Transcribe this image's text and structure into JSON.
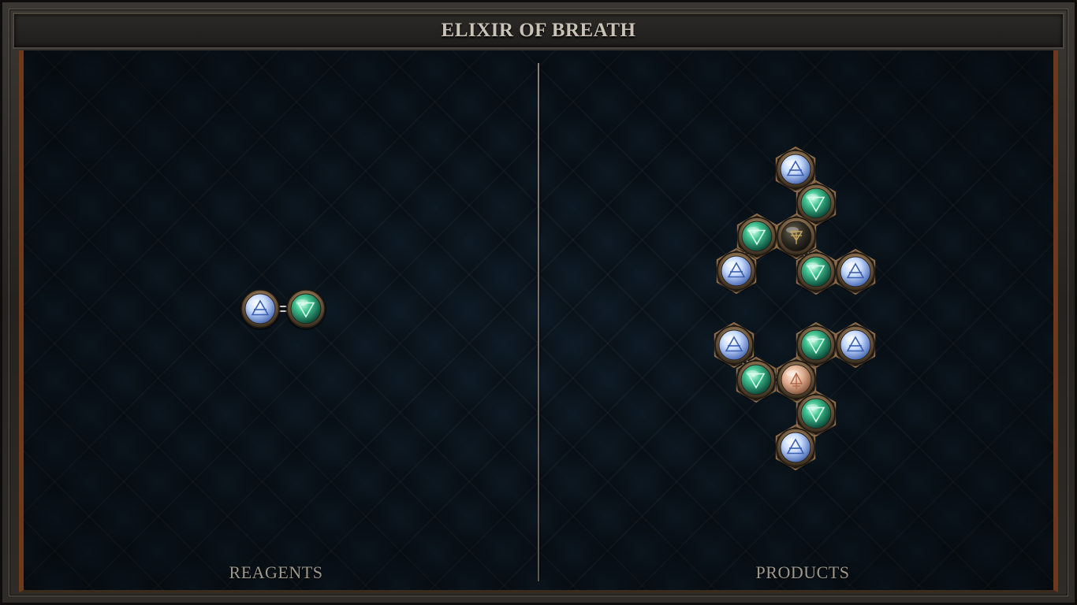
{
  "title": "ELIXIR OF BREATH",
  "panels": {
    "reagents_label": "REAGENTS",
    "products_label": "PRODUCTS"
  },
  "symbols": {
    "air": "air-triangle-icon",
    "water": "water-triangle-icon",
    "salt": "salt-triangle-icon",
    "fire": "fire-triangle-icon"
  },
  "colors": {
    "air": "#cfe0ff",
    "water": "#44c29a",
    "dark_center": "#2b2a22",
    "copper_center": "#e4b498",
    "frame_brass": "#8b6b4a"
  },
  "molecules": {
    "reagent": {
      "atoms": [
        "air",
        "water"
      ],
      "bonds": [
        [
          0,
          1
        ]
      ]
    },
    "product_1": {
      "atoms": [
        "air",
        "water",
        "water",
        "dark",
        "air",
        "water",
        "air"
      ],
      "bonds": [
        [
          0,
          1
        ],
        [
          1,
          3
        ],
        [
          2,
          3
        ],
        [
          2,
          4
        ],
        [
          3,
          5
        ],
        [
          5,
          6
        ]
      ]
    },
    "product_2": {
      "atoms": [
        "air",
        "water",
        "copper",
        "water",
        "air",
        "water",
        "air"
      ],
      "bonds": [
        [
          0,
          1
        ],
        [
          1,
          2
        ],
        [
          2,
          3
        ],
        [
          3,
          4
        ],
        [
          2,
          5
        ],
        [
          5,
          6
        ]
      ]
    }
  }
}
